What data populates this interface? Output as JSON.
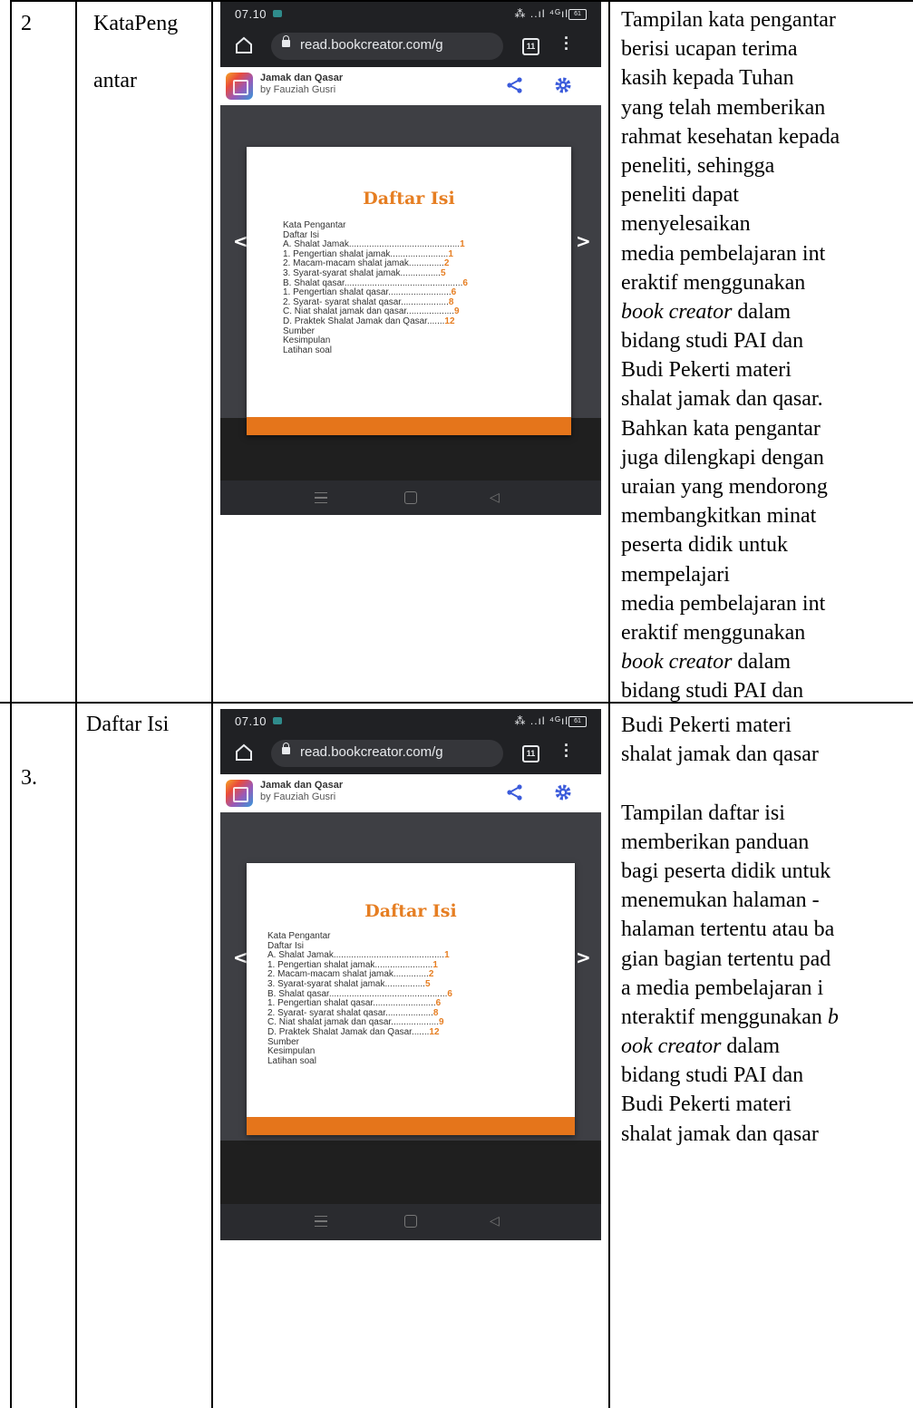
{
  "rows": [
    {
      "number": "2",
      "name_lines": [
        "KataPeng",
        "antar"
      ]
    },
    {
      "number": "3.",
      "name_lines": [
        "Daftar Isi"
      ]
    }
  ],
  "phone": {
    "time": "07.10",
    "status_icons": "… ..│ ⁴ᴳ│",
    "battery": "61",
    "url": "read.bookcreator.com/g",
    "tab_count": "11",
    "book_title": "Jamak dan Qasar",
    "book_author": "by Fauziah Gusri",
    "prev_button": "<",
    "next_button": ">",
    "page_title": "Daftar Isi",
    "toc": [
      {
        "text": "Kata Pengantar",
        "page": ""
      },
      {
        "text": "Daftar Isi",
        "page": ""
      },
      {
        "text": "A. Shalat Jamak............................................",
        "page": "1"
      },
      {
        "text": " 1. Pengertian shalat jamak.......................",
        "page": "1"
      },
      {
        "text": " 2. Macam-macam shalat jamak..............",
        "page": "2"
      },
      {
        "text": " 3. Syarat-syarat shalat jamak................",
        "page": "5"
      },
      {
        "text": "B. Shalat qasar...............................................",
        "page": "6"
      },
      {
        "text": " 1. Pengertian shalat qasar.........................",
        "page": "6"
      },
      {
        "text": " 2. Syarat- syarat shalat qasar...................",
        "page": "8"
      },
      {
        "text": "C. Niat shalat jamak dan qasar...................",
        "page": "9"
      },
      {
        "text": "D. Praktek Shalat Jamak dan Qasar.......",
        "page": "12"
      },
      {
        "text": "Sumber",
        "page": ""
      },
      {
        "text": "Kesimpulan",
        "page": ""
      },
      {
        "text": "Latihan soal",
        "page": ""
      }
    ],
    "nav_buttons": [
      "≡",
      "▢",
      "◁"
    ]
  },
  "description_lines": [
    {
      "text": "Tampilan kata pengantar",
      "italic": false
    },
    {
      "text": "berisi ucapan terima",
      "italic": false
    },
    {
      "text": "kasih kepada Tuhan",
      "italic": false
    },
    {
      "text": "yang telah memberikan",
      "italic": false
    },
    {
      "text": "rahmat kesehatan kepada",
      "italic": false
    },
    {
      "text": "peneliti, sehingga",
      "italic": false
    },
    {
      "text": "peneliti dapat",
      "italic": false
    },
    {
      "text": "menyelesaikan",
      "italic": false
    },
    {
      "text": "media  pembelajaran  int",
      "italic": false
    },
    {
      "text": "eraktif menggunakan",
      "italic": false
    },
    {
      "text": "book creator dalam",
      "italic": false,
      "italic_prefix": "book creator"
    },
    {
      "text": "bidang studi PAI dan",
      "italic": false
    },
    {
      "text": "Budi Pekerti materi",
      "italic": false
    },
    {
      "text": "shalat jamak dan qasar.",
      "italic": false
    },
    {
      "text": "Bahkan kata pengantar",
      "italic": false
    },
    {
      "text": "juga dilengkapi dengan",
      "italic": false
    },
    {
      "text": "uraian yang mendorong",
      "italic": false
    },
    {
      "text": "membangkitkan minat",
      "italic": false
    },
    {
      "text": "peserta didik untuk",
      "italic": false
    },
    {
      "text": "mempelajari",
      "italic": false
    },
    {
      "text": "media  pembelajaran  int",
      "italic": false
    },
    {
      "text": "eraktif menggunakan",
      "italic": false
    },
    {
      "text": "book creator dalam",
      "italic": false,
      "italic_prefix": "book creator"
    },
    {
      "text": "bidang studi PAI dan",
      "italic": false
    }
  ],
  "description_lines_2": [
    {
      "text": "Budi Pekerti materi"
    },
    {
      "text": "shalat jamak dan qasar"
    },
    {
      "text": ""
    },
    {
      "text": "Tampilan daftar isi"
    },
    {
      "text": "memberikan panduan"
    },
    {
      "text": "bagi peserta didik  untuk"
    },
    {
      "text": " menemukan halaman -"
    },
    {
      "text": "halaman tertentu atau ba"
    },
    {
      "text": "gian bagian  tertentu pad"
    },
    {
      "text": "a media  pembelajaran  i"
    },
    {
      "text": "nteraktif menggunakan b",
      "italic_suffix": "b"
    },
    {
      "text": "ook creator dalam",
      "italic_prefix": "ook creator"
    },
    {
      "text": "bidang studi PAI dan"
    },
    {
      "text": "Budi Pekerti materi"
    },
    {
      "text": "shalat jamak dan qasar"
    }
  ]
}
